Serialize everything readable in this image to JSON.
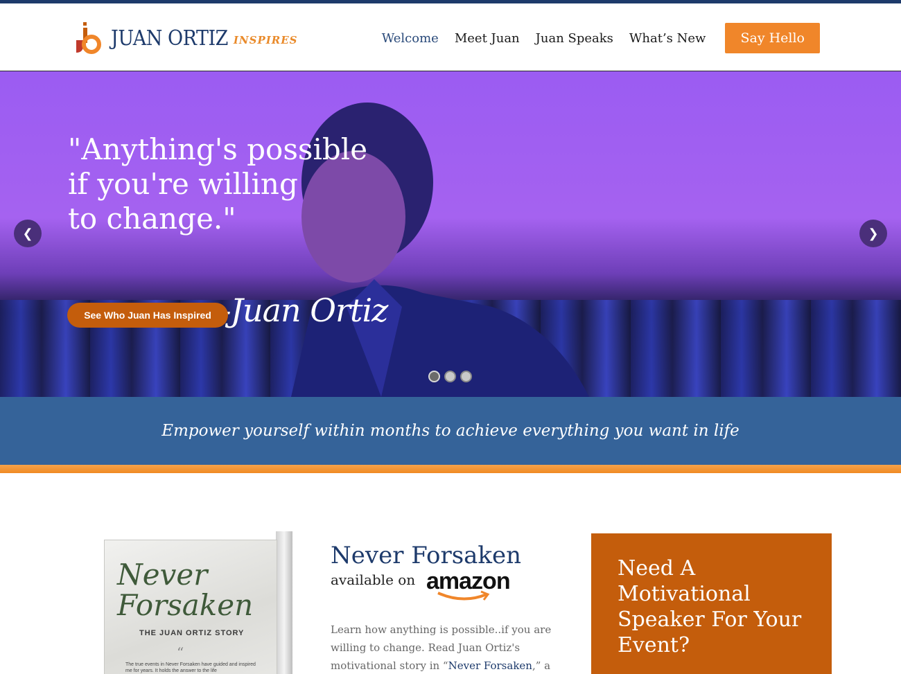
{
  "brand": {
    "name": "JUAN ORTIZ",
    "tagline": "INSPIRES",
    "colors": {
      "navy": "#1d3a6b",
      "orange": "#f0862a",
      "burnt_orange": "#c45d0c",
      "banner_blue": "#356399"
    }
  },
  "nav": {
    "items": [
      {
        "label": "Welcome",
        "active": true
      },
      {
        "label": "Meet Juan",
        "active": false
      },
      {
        "label": "Juan Speaks",
        "active": false
      },
      {
        "label": "What’s New",
        "active": false
      }
    ],
    "cta_label": "Say Hello"
  },
  "hero": {
    "quote": "\"Anything's possible\nif you're willing\nto change.\"",
    "signature": "-Juan Ortiz",
    "button_label": "See Who Juan Has Inspired",
    "prev_icon": "chevron-left-icon",
    "next_icon": "chevron-right-icon",
    "slide_count": 3,
    "active_slide": 1
  },
  "banner": {
    "text": "Empower yourself within months to achieve everything you want in life"
  },
  "book": {
    "cover_title_line1": "Never",
    "cover_title_line2": "Forsaken",
    "cover_subtitle": "THE JUAN ORTIZ STORY",
    "cover_quote": "The true events in Never Forsaken have guided and inspired me for years. It holds the answer to the life"
  },
  "promo": {
    "title": "Never Forsaken",
    "available_on": "available on",
    "store": "amazon",
    "body_before": "Learn how anything is possible..if you are willing to change. Read Juan Ortiz's motivational story in “",
    "body_link": "Never Forsaken",
    "body_after": ",” a"
  },
  "speaker": {
    "text": "Need A Motivational Speaker For Your Event?"
  }
}
